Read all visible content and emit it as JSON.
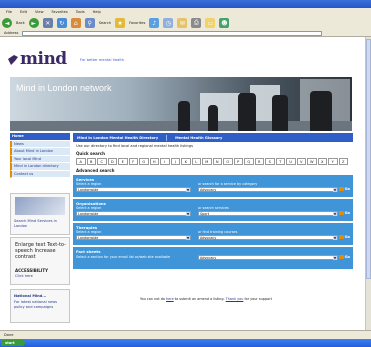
{
  "browser": {
    "menu": [
      "File",
      "Edit",
      "View",
      "Favorites",
      "Tools",
      "Help"
    ],
    "back_label": "Back",
    "search_label": "Search",
    "favorites_label": "Favorites",
    "address_label": "Address",
    "status": "Done",
    "start_label": "start"
  },
  "site": {
    "logo": "mind",
    "tagline": "For better mental health",
    "banner_title": "Mind in London network"
  },
  "sidebar": {
    "items": [
      "Home",
      "News",
      "About Mind in London",
      "Your local Mind",
      "Mind in London directory",
      "Contact us"
    ]
  },
  "promos": {
    "search_text": "Search Mind Services in London",
    "enlarge_text": "Enlarge text Text-to-speech Increase contrast",
    "accessibility": "ACCESSIBILITY",
    "click_here": "Click here",
    "national_title": "National Mind...",
    "national_text": "For latest national news policy and campaigns"
  },
  "main": {
    "tab1": "Mind in London Mental Health Directory",
    "tab2": "Mental Health Glossary",
    "intro": "Use our directory to find local and regional mental health listings",
    "quick_title": "Quick search",
    "letters": [
      "A",
      "B",
      "C",
      "D",
      "E",
      "F",
      "G",
      "H",
      "I",
      "J",
      "K",
      "L",
      "M",
      "N",
      "O",
      "P",
      "Q",
      "R",
      "S",
      "T",
      "U",
      "V",
      "W",
      "X",
      "Y",
      "Z"
    ],
    "advanced_title": "Advanced search",
    "go_label": "Go",
    "panels": [
      {
        "title": "Services",
        "left_label": "Select a region",
        "left_value": "Londonwide",
        "right_label": "or search for a service by category",
        "right_value": "Advocacy"
      },
      {
        "title": "Organisations",
        "left_label": "Select a region",
        "left_value": "Londonwide",
        "right_label": "or search services",
        "right_value": "Sport"
      },
      {
        "title": "Therapies",
        "left_label": "Select a region",
        "left_value": "Londonwide",
        "right_label": "or find training courses",
        "right_value": "Advocacy"
      },
      {
        "title": "Fact sheets",
        "left_label": "Select a section for your email list or/web site available",
        "left_value": "",
        "right_label": "",
        "right_value": "Advocacy"
      }
    ],
    "footer_pre": "You can not do",
    "footer_link": "here",
    "footer_mid": "to submit an amend a listing.",
    "footer_thanks": "Thank you",
    "footer_post": "for your support"
  }
}
